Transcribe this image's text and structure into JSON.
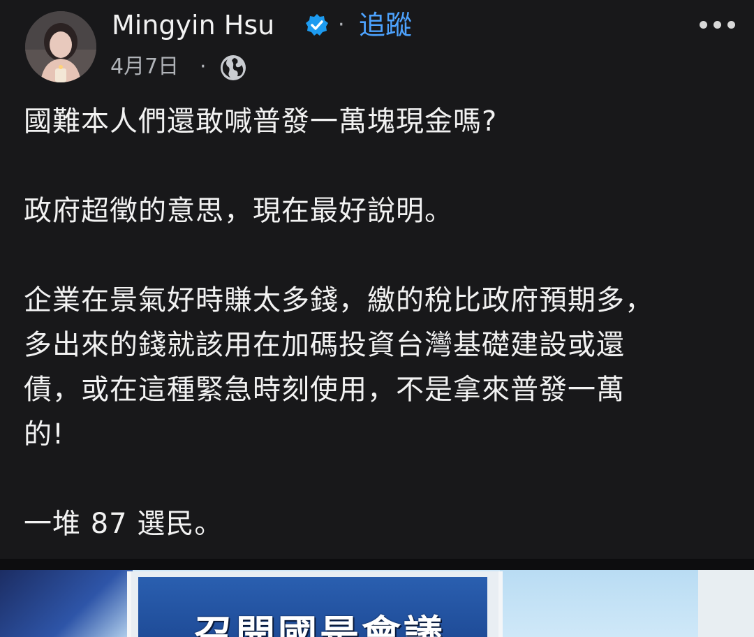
{
  "post": {
    "author": {
      "name": "Mingyin Hsu",
      "verified": true,
      "follow_label": "追蹤",
      "separator": "·"
    },
    "meta": {
      "date": "4月7日",
      "separator": "·",
      "audience_icon": "globe-icon"
    },
    "more_icon": "more-horizontal-icon",
    "paragraphs": [
      {
        "lines": [
          "國難本人們還敢喊普發一萬塊現金嗎?"
        ]
      },
      {
        "lines": [
          "政府超徵的意思，現在最好說明。"
        ]
      },
      {
        "lines": [
          "企業在景氣好時賺太多錢，繳的稅比政府預期多，",
          "多出來的錢就該用在加碼投資台灣基礎建設或還",
          "債，或在這種緊急時刻使用，不是拿來普發一萬",
          "的!"
        ]
      },
      {
        "lines": [
          "一堆 87 選民。"
        ]
      }
    ],
    "media": {
      "caption": "召開國是會議"
    }
  },
  "colors": {
    "background": "#18181a",
    "text": "#f2f2f2",
    "secondary_text": "#b0b3b8",
    "link": "#4da3ff",
    "verified_badge": "#1d9bf0"
  }
}
